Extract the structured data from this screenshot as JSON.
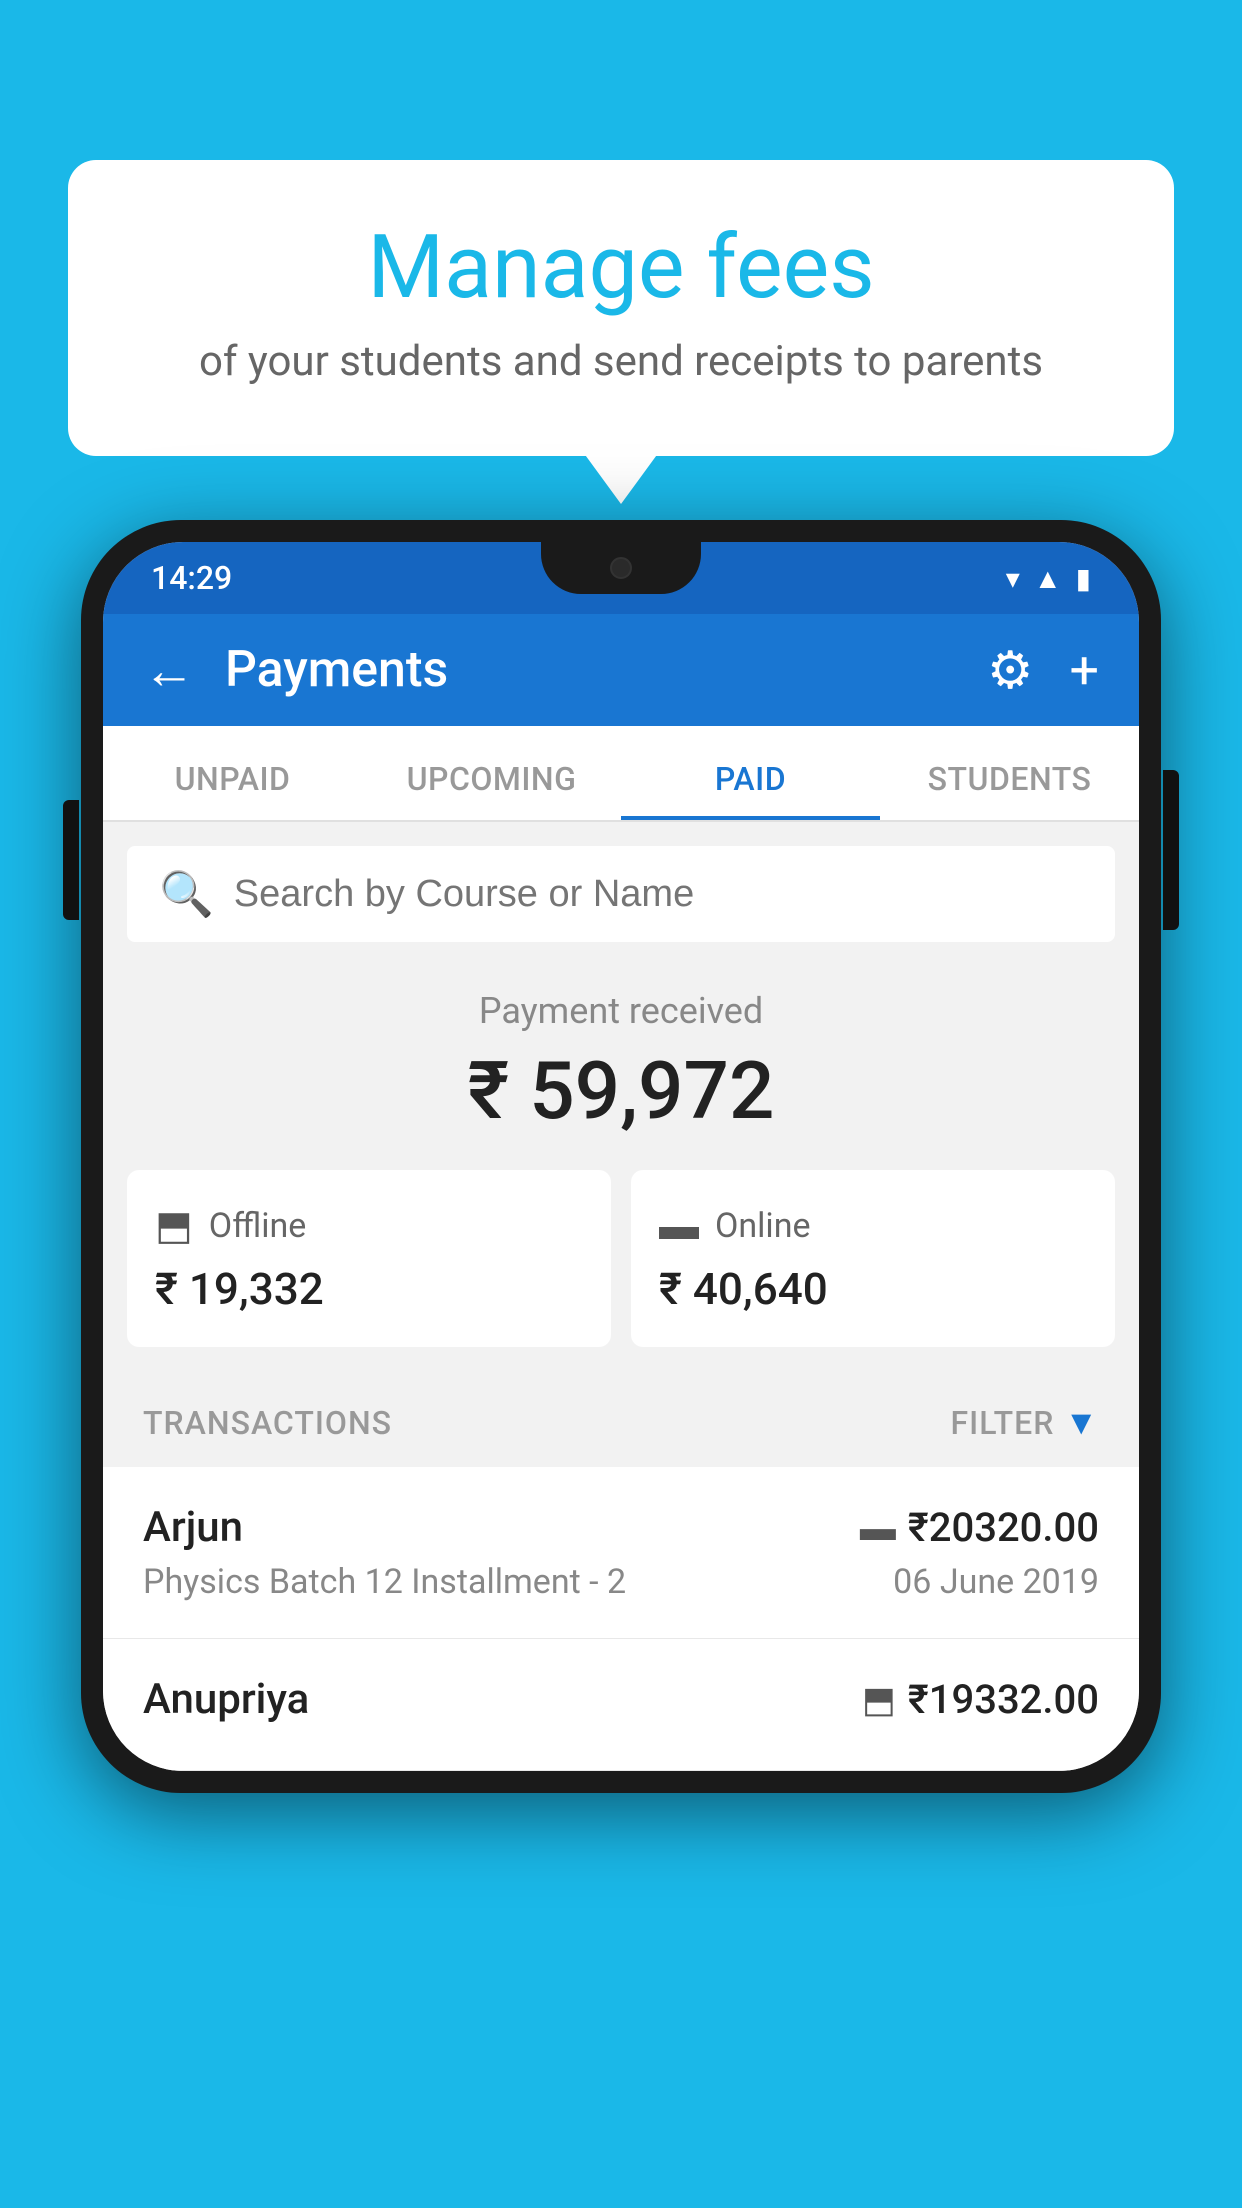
{
  "bubble": {
    "title": "Manage fees",
    "subtitle": "of your students and send receipts to parents"
  },
  "status_bar": {
    "time": "14:29",
    "icons": [
      "wifi",
      "signal",
      "battery"
    ]
  },
  "app_bar": {
    "title": "Payments",
    "back_label": "←",
    "settings_label": "⚙",
    "add_label": "+"
  },
  "tabs": [
    {
      "label": "UNPAID",
      "active": false
    },
    {
      "label": "UPCOMING",
      "active": false
    },
    {
      "label": "PAID",
      "active": true
    },
    {
      "label": "STUDENTS",
      "active": false
    }
  ],
  "search": {
    "placeholder": "Search by Course or Name"
  },
  "payment": {
    "label": "Payment received",
    "amount": "₹ 59,972",
    "offline_label": "Offline",
    "offline_amount": "₹ 19,332",
    "online_label": "Online",
    "online_amount": "₹ 40,640"
  },
  "transactions": {
    "header": "TRANSACTIONS",
    "filter": "FILTER",
    "rows": [
      {
        "name": "Arjun",
        "detail": "Physics Batch 12 Installment - 2",
        "amount": "₹20320.00",
        "date": "06 June 2019",
        "payment_type": "card"
      },
      {
        "name": "Anupriya",
        "detail": "",
        "amount": "₹19332.00",
        "date": "",
        "payment_type": "offline"
      }
    ]
  }
}
